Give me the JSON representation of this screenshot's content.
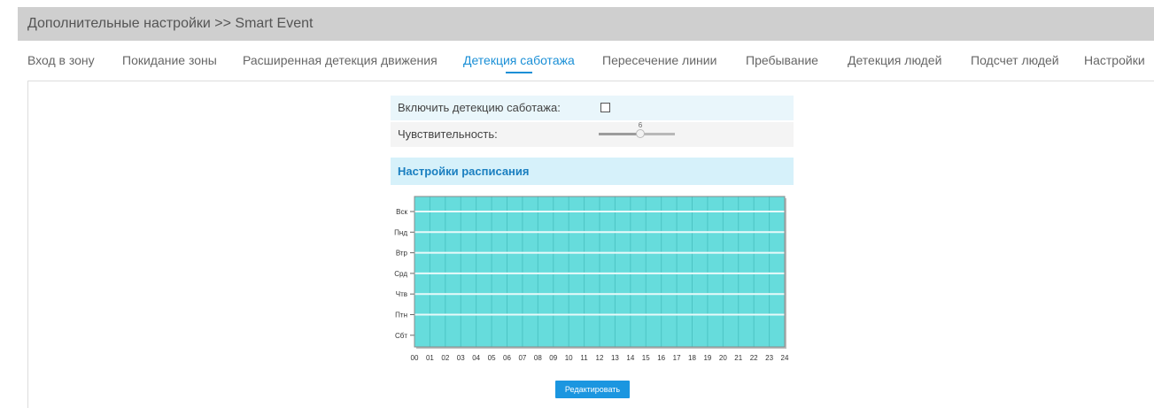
{
  "breadcrumb": {
    "text": "Дополнительные настройки >> Smart Event"
  },
  "tabs": [
    {
      "label": "Вход в зону"
    },
    {
      "label": "Покидание зоны"
    },
    {
      "label": "Расширенная детекция движения"
    },
    {
      "label": "Детекция саботажа",
      "active": true
    },
    {
      "label": "Пересечение линии"
    },
    {
      "label": "Пребывание"
    },
    {
      "label": "Детекция людей"
    },
    {
      "label": "Подсчет людей"
    },
    {
      "label": "Настройки"
    }
  ],
  "settings": {
    "enable_label": "Включить детекцию саботажа:",
    "enable_checked": false,
    "sensitivity_label": "Чувствительность:",
    "sensitivity_value": "6",
    "sensitivity_fraction": 0.55
  },
  "schedule": {
    "title": "Настройки расписания",
    "days": [
      "Вск",
      "Пнд",
      "Втр",
      "Срд",
      "Чтв",
      "Птн",
      "Сбт"
    ],
    "hours": [
      "00",
      "01",
      "02",
      "03",
      "04",
      "05",
      "06",
      "07",
      "08",
      "09",
      "10",
      "11",
      "12",
      "13",
      "14",
      "15",
      "16",
      "17",
      "18",
      "19",
      "20",
      "21",
      "22",
      "23",
      "24"
    ],
    "fill_color": "#66dcdc",
    "grid_color": "#4cc4c4",
    "separator_color": "#e8fafa",
    "edit_label": "Редактировать"
  },
  "colors": {
    "accent": "#1a8fd6",
    "header_bg": "#cfcfcf",
    "button_bg": "#1b96e0"
  }
}
